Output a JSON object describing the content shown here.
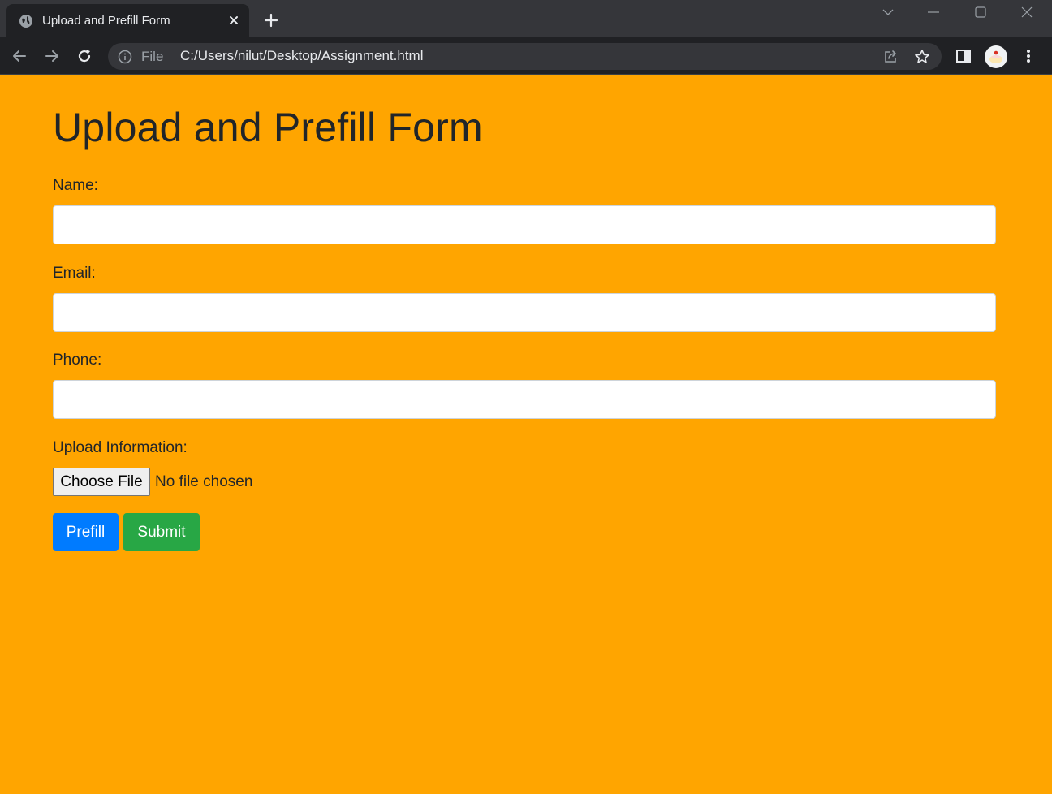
{
  "browser": {
    "tab_title": "Upload and Prefill Form",
    "scheme_label": "File",
    "url": "C:/Users/nilut/Desktop/Assignment.html",
    "icons": [
      "globe-icon",
      "close-icon",
      "plus-icon",
      "back-arrow-icon",
      "forward-arrow-icon",
      "reload-icon",
      "info-icon",
      "share-icon",
      "star-icon",
      "side-panel-icon",
      "avatar",
      "more-icon",
      "tab-search-icon",
      "minimize-icon",
      "maximize-icon",
      "window-close-icon"
    ]
  },
  "form": {
    "title": "Upload and Prefill Form",
    "name_label": "Name:",
    "name_value": "",
    "email_label": "Email:",
    "email_value": "",
    "phone_label": "Phone:",
    "phone_value": "",
    "upload_label": "Upload Information:",
    "choose_file_label": "Choose File",
    "file_status": "No file chosen",
    "prefill_label": "Prefill",
    "submit_label": "Submit"
  },
  "colors": {
    "page_background": "#ffa500",
    "prefill_button": "#007bff",
    "submit_button": "#28a745",
    "text": "#212529"
  }
}
